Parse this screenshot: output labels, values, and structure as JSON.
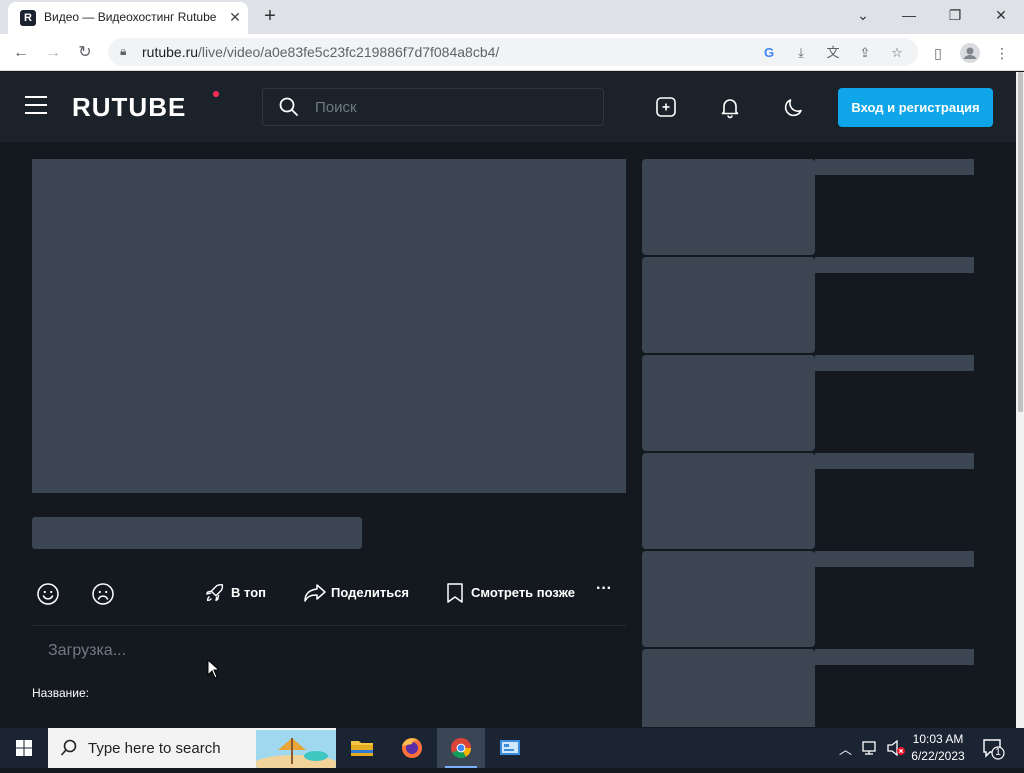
{
  "browser": {
    "tab_title": "Видео — Видеохостинг Rutube",
    "tab_favicon_letter": "R",
    "url_host": "rutube.ru",
    "url_path": "/live/video/a0e83fe5c23fc219886f7d7f084a8cb4/"
  },
  "header": {
    "logo": "RUTUBE",
    "search_placeholder": "Поиск",
    "login_label": "Вход и регистрация"
  },
  "actions": {
    "top_label": "В топ",
    "share_label": "Поделиться",
    "later_label": "Смотреть позже",
    "more_label": "···"
  },
  "video": {
    "loading_text": "Загрузка...",
    "name_label": "Название:"
  },
  "taskbar": {
    "search_placeholder": "Type here to search",
    "time": "10:03 AM",
    "date": "6/22/2023",
    "notification_count": "1"
  },
  "colors": {
    "accent": "#0ea5e9",
    "header_bg": "#1c2229",
    "page_bg": "#14191f",
    "skeleton": "#3c4652"
  }
}
